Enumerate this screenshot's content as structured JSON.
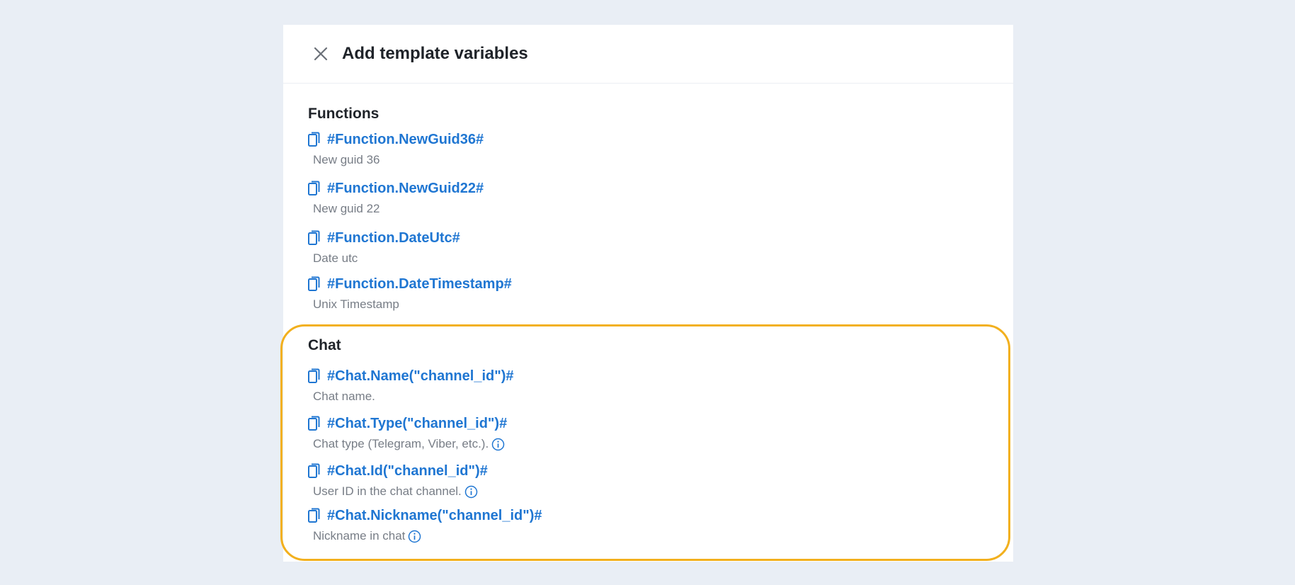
{
  "dialog": {
    "title": "Add template variables",
    "close_icon": "close-icon"
  },
  "sections": {
    "functions": {
      "title": "Functions",
      "items": [
        {
          "name": "#Function.NewGuid36#",
          "description": "New guid 36"
        },
        {
          "name": "#Function.NewGuid22#",
          "description": "New guid 22"
        },
        {
          "name": "#Function.DateUtc#",
          "description": "Date utc"
        },
        {
          "name": "#Function.DateTimestamp#",
          "description": "Unix Timestamp"
        }
      ]
    },
    "chat": {
      "title": "Chat",
      "items": [
        {
          "name": "#Chat.Name(\"channel_id\")#",
          "description": "Chat name.",
          "info": false
        },
        {
          "name": "#Chat.Type(\"channel_id\")#",
          "description": "Chat type (Telegram, Viber, etc.).",
          "info": true
        },
        {
          "name": "#Chat.Id(\"channel_id\")#",
          "description": "User ID in the chat channel.",
          "info": true
        },
        {
          "name": "#Chat.Nickname(\"channel_id\")#",
          "description": "Nickname in chat",
          "info": true
        }
      ]
    }
  },
  "icons": {
    "copy": "copy-icon",
    "info": "info-icon"
  },
  "colors": {
    "background": "#e9eef5",
    "panel": "#ffffff",
    "link": "#1f76d2",
    "description": "#777d86",
    "highlight": "#f2b01e"
  }
}
